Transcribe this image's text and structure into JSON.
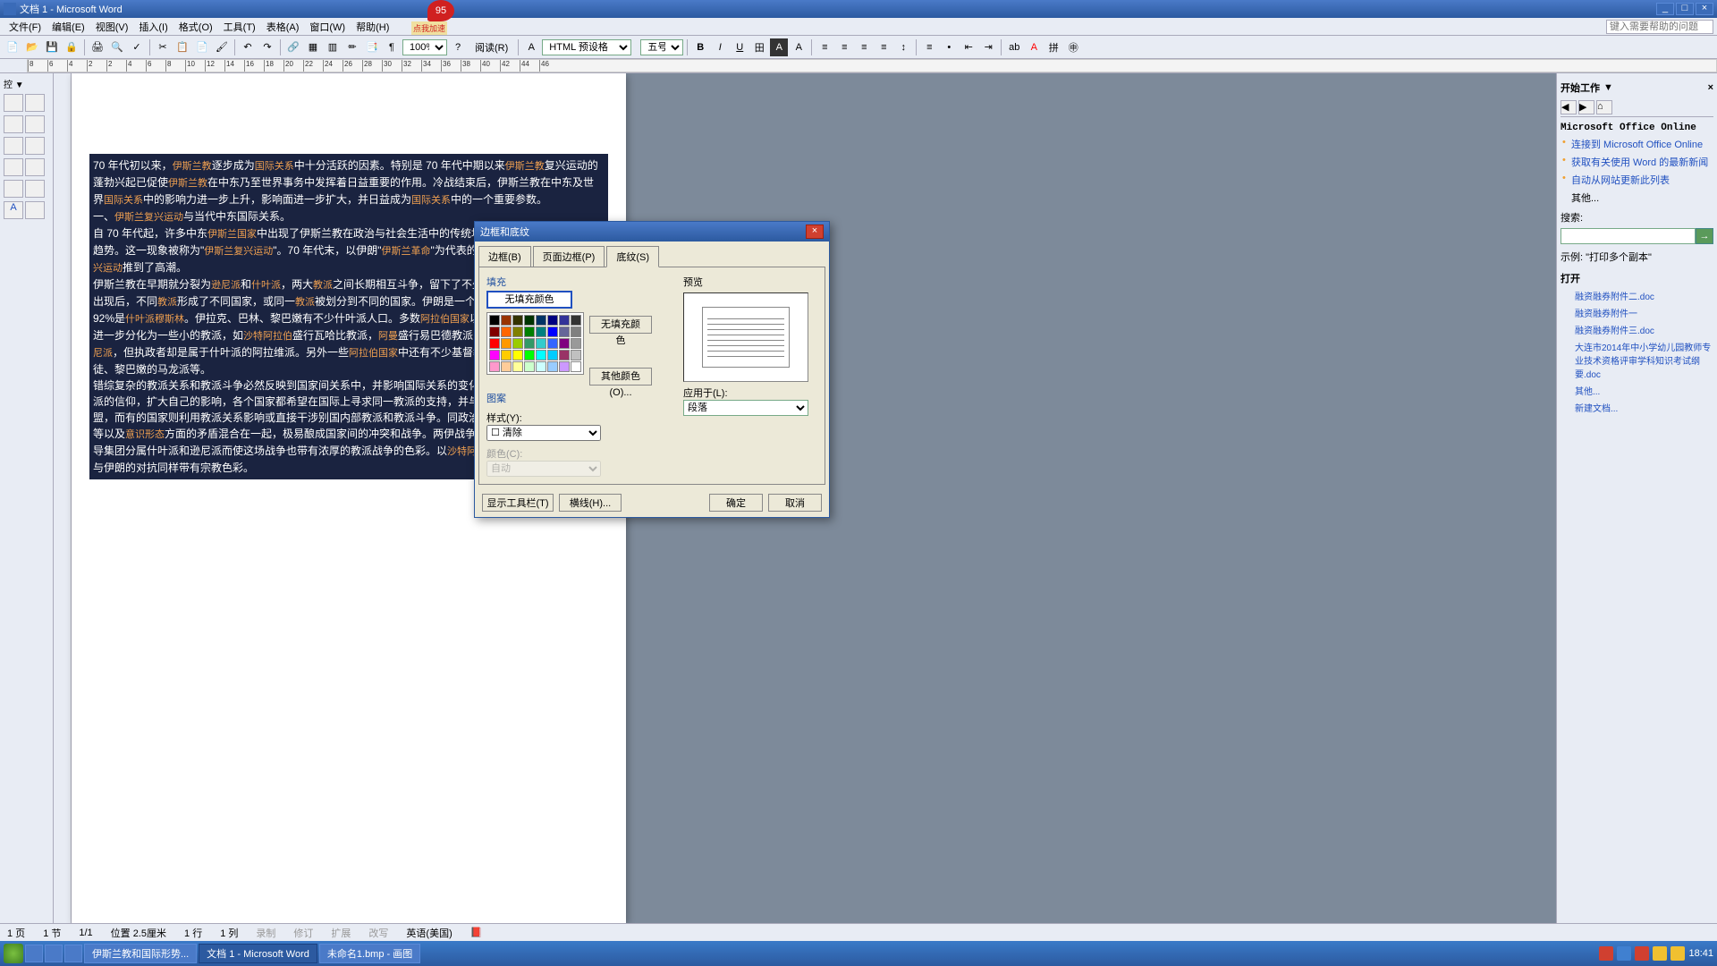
{
  "title": "文档 1 - Microsoft Word",
  "accelerator": {
    "badge": "95",
    "text": "点我加速"
  },
  "menus": [
    "文件(F)",
    "编辑(E)",
    "视图(V)",
    "插入(I)",
    "格式(O)",
    "工具(T)",
    "表格(A)",
    "窗口(W)",
    "帮助(H)"
  ],
  "help_placeholder": "键入需要帮助的问题",
  "toolbar2": {
    "zoom": "100%",
    "read": "阅读(R)",
    "style": "HTML 预设格",
    "fontsize": "五号"
  },
  "ruler_marks": [
    "8",
    "6",
    "4",
    "2",
    "2",
    "4",
    "6",
    "8",
    "10",
    "12",
    "14",
    "16",
    "18",
    "20",
    "22",
    "24",
    "26",
    "28",
    "30",
    "32",
    "34",
    "36",
    "38",
    "40",
    "42",
    "44",
    "46"
  ],
  "doc_text": "70 年代初以来，<hl>伊斯兰教</hl>逐步成为<hl>国际关系</hl>中十分活跃的因素。特别是 70 年代中期以来<hl>伊斯兰教</hl>复兴运动的蓬勃兴起已促使<hl>伊斯兰教</hl>在中东乃至世界事务中发挥着日益重要的作用。冷战结束后，伊斯兰教在中东及世界<hl>国际关系</hl>中的影响力进一步上升，影响面进一步扩大，并日益成为<hl>国际关系</hl>中的一个重要参数。<br>一、<hl>伊斯兰复兴运动</hl>与当代中东国际关系。<br>自 70 年代起，许多中东<hl>伊斯兰国家</hl>中出现了伊斯兰教在政治与社会生活中的传统地位逐步恢复及不断加强的趋势。这一现象被称为\"<hl>伊斯兰复兴运动</hl>\"。70 年代末，以伊朗\"<hl>伊斯兰革命</hl>\"为代表的一系列重大事件把<hl>伊斯兰复兴运动</hl>推到了高潮。<br>伊斯兰教在早期就分裂为<hl>逊尼派</hl>和<hl>什叶派</hl>，两大<hl>教派</hl>之间长期相互斗争，留下了不少历史宿怨。近代<hl>民族国家</hl>出现后，不同<hl>教派</hl>形成了不同国家，或同一<hl>教派</hl>被划分到不同的国家。伊朗是一个<hl>什叶派</hl>国家，其人口的 92%是<hl>什叶派穆斯林</hl>。伊拉克、巴林、黎巴嫩有不少什叶派人口。多数<hl>阿拉伯国家</hl>以<hl>逊尼派</hl>为主体，但他们又进一步分化为一些小的教派，如<hl>沙特阿拉伯</hl>盛行瓦哈比教派，<hl>阿曼</hl>盛行易巴德教派，而<hl>叙利亚</hl>人口中多数是<hl>逊尼派</hl>，但执政者却是属于什叶派的阿拉维派。另外一些<hl>阿拉伯国家</hl>中还有不少基督教徒，如埃及的科普特教徒、黎巴嫩的马龙派等。<br>错综复杂的教派关系和教派斗争必然反映到国家间关系中，并影响国际关系的变化和走向。为了保持自己教派的信仰，扩大自己的影响，各个国家都希望在国际上寻求同一教派的支持，并与国外的同一教派结成联盟，而有的国家则利用教派关系影响或直接干涉别国内部教派和教派斗争。同政治、经济、民族、社会制度等以及<hl>意识形态</hl>方面的矛盾混合在一起，极易酿成国家间的冲突和战争。两伊战争由于伊朗、伊拉克上层领导集团分属什叶派和逊尼派而使这场战争也带有浓厚的教派战争的色彩。以<hl>沙特阿拉伯</hl>为首的海湾合作委员会与伊朗的对抗同样带有宗教色彩。",
  "taskpane": {
    "title": "开始工作",
    "online_header": "Microsoft Office Online",
    "links": [
      "连接到 Microsoft Office Online",
      "获取有关使用 Word 的最新新闻",
      "自动从网站更新此列表",
      "其他..."
    ],
    "search_label": "搜索:",
    "example_label": "示例:",
    "example_text": "\"打印多个副本\"",
    "open_label": "打开",
    "recent": [
      "融资融券附件二.doc",
      "融资融券附件一",
      "融资融券附件三.doc",
      "大连市2014年中小学幼儿园教师专业技术资格评审学科知识考试纲要.doc",
      "其他..."
    ],
    "newdoc": "新建文档..."
  },
  "dialog": {
    "title": "边框和底纹",
    "tabs": [
      "边框(B)",
      "页面边框(P)",
      "底纹(S)"
    ],
    "active_tab": 2,
    "fill_label": "填充",
    "nofill_btn": "无填充颜色",
    "nofill_label": "无填充颜色",
    "more_colors": "其他颜色(O)...",
    "pattern_label": "图案",
    "style_label": "样式(Y):",
    "style_value": "清除",
    "color_label": "颜色(C):",
    "color_value": "自动",
    "preview_label": "预览",
    "applyto_label": "应用于(L):",
    "applyto_value": "段落",
    "show_toolbar": "显示工具栏(T)",
    "hline": "横线(H)...",
    "ok": "确定",
    "cancel": "取消"
  },
  "statusbar": {
    "page": "1 页",
    "sec": "1 节",
    "pageof": "1/1",
    "pos": "位置 2.5厘米",
    "line": "1 行",
    "col": "1 列",
    "rec": "录制",
    "rev": "修订",
    "ext": "扩展",
    "ovr": "改写",
    "lang": "英语(美国)"
  },
  "taskbar": {
    "tasks": [
      "伊斯兰教和国际形势...",
      "文档 1 - Microsoft Word",
      "未命名1.bmp - 画图"
    ],
    "time": "18:41"
  },
  "palette_colors": [
    "#000000",
    "#993300",
    "#333300",
    "#003300",
    "#003366",
    "#000080",
    "#333399",
    "#333333",
    "#800000",
    "#ff6600",
    "#808000",
    "#008000",
    "#008080",
    "#0000ff",
    "#666699",
    "#808080",
    "#ff0000",
    "#ff9900",
    "#99cc00",
    "#339966",
    "#33cccc",
    "#3366ff",
    "#800080",
    "#999999",
    "#ff00ff",
    "#ffcc00",
    "#ffff00",
    "#00ff00",
    "#00ffff",
    "#00ccff",
    "#993366",
    "#c0c0c0",
    "#ff99cc",
    "#ffcc99",
    "#ffff99",
    "#ccffcc",
    "#ccffff",
    "#99ccff",
    "#cc99ff",
    "#ffffff"
  ]
}
